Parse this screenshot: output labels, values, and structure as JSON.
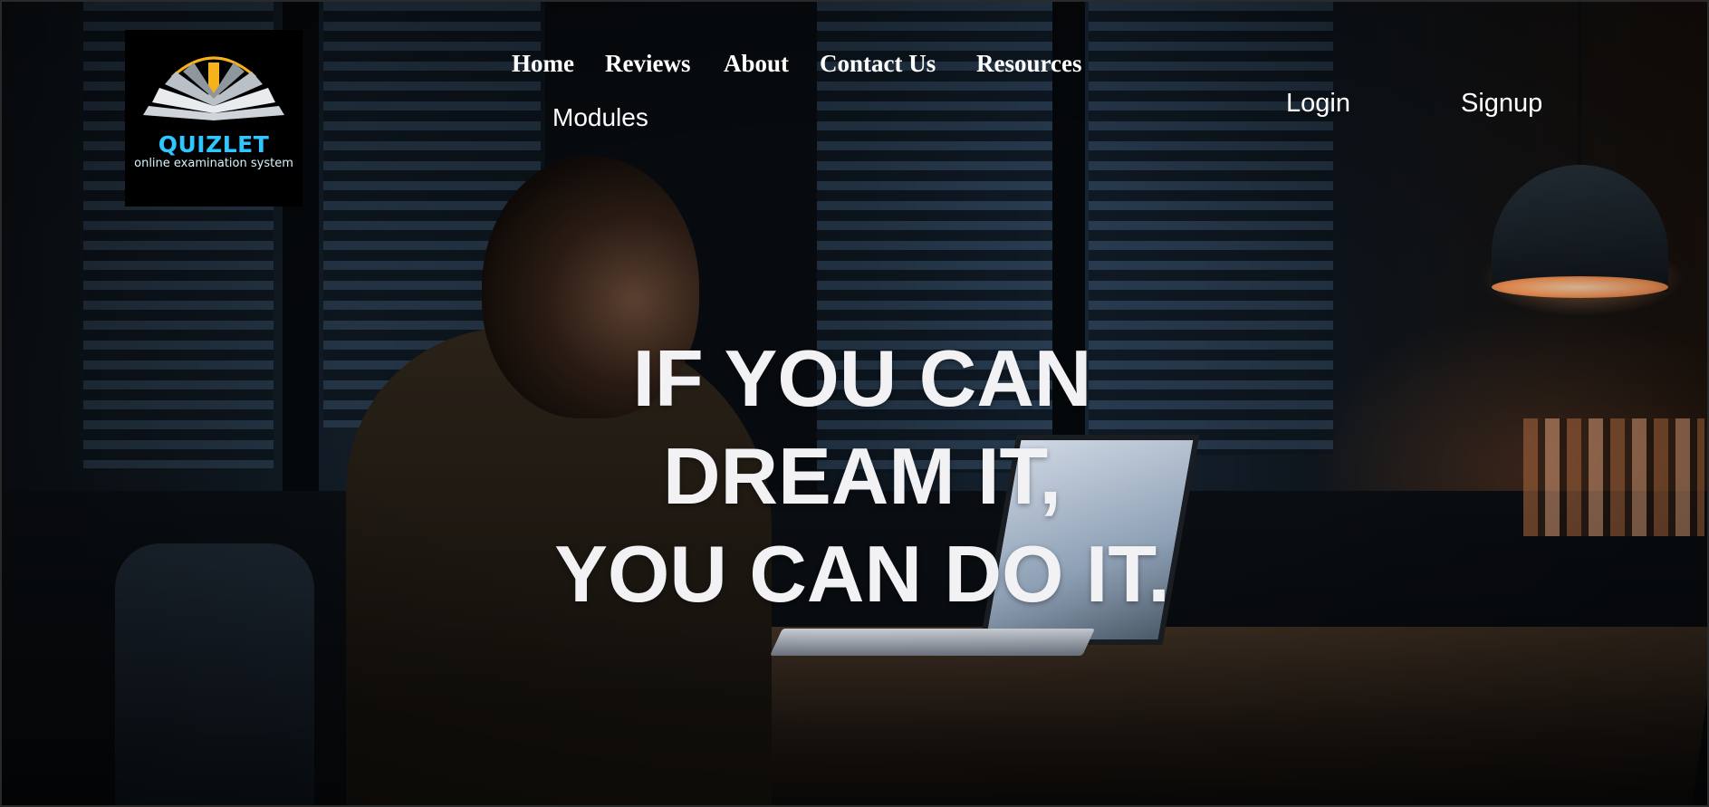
{
  "logo": {
    "title": "QUIZLET",
    "subtitle": "online examination system",
    "icon": "open-book-with-pencil"
  },
  "nav": {
    "items": [
      {
        "label": "Home"
      },
      {
        "label": "Reviews"
      },
      {
        "label": "About"
      },
      {
        "label": "Contact Us"
      },
      {
        "label": "Resources"
      }
    ],
    "modules": "Modules"
  },
  "auth": {
    "login": "Login",
    "signup": "Signup"
  },
  "hero": {
    "lines": [
      "IF YOU CAN",
      "DREAM IT,",
      "YOU CAN DO IT."
    ]
  },
  "colors": {
    "logo_accent": "#2ec7ff",
    "pencil": "#f5b21c",
    "text": "#ffffff"
  }
}
